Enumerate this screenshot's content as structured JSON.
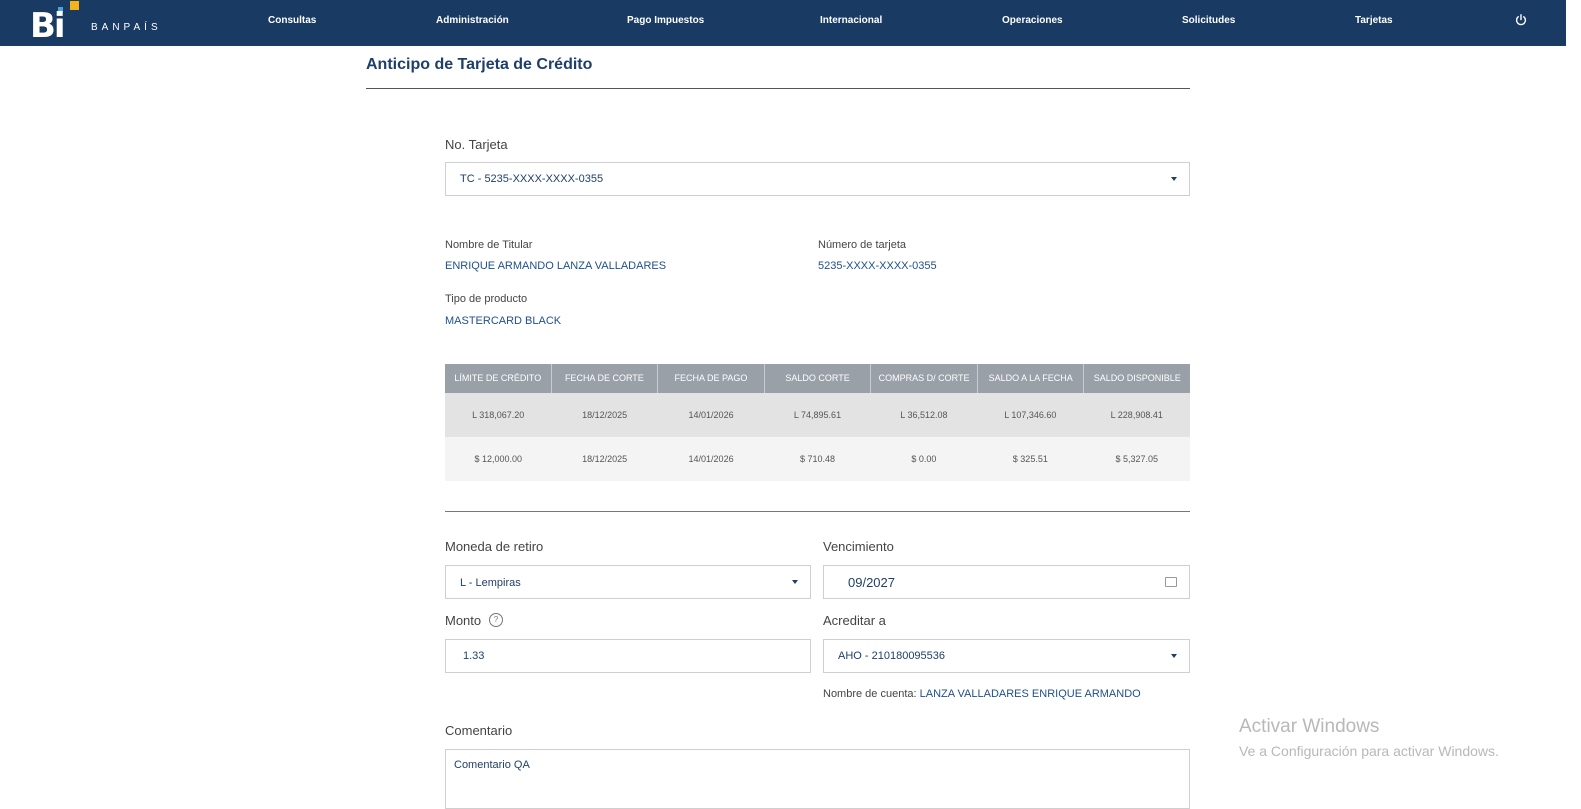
{
  "brand": {
    "logo": "Bi",
    "name": "BANPAÍS"
  },
  "nav": {
    "items": [
      "Consultas",
      "Administración",
      "Pago Impuestos",
      "Internacional",
      "Operaciones",
      "Solicitudes",
      "Tarjetas"
    ],
    "power_icon": "power-icon"
  },
  "page": {
    "title": "Anticipo de Tarjeta de Crédito"
  },
  "card_select": {
    "label": "No. Tarjeta",
    "value": "TC - 5235-XXXX-XXXX-0355"
  },
  "details": {
    "holder_label": "Nombre de Titular",
    "holder_value": "ENRIQUE ARMANDO LANZA VALLADARES",
    "card_number_label": "Número de tarjeta",
    "card_number_value": "5235-XXXX-XXXX-0355",
    "product_label": "Tipo de producto",
    "product_value": "MASTERCARD BLACK"
  },
  "balance_table": {
    "headers": [
      "LÍMITE DE CRÉDITO",
      "FECHA DE CORTE",
      "FECHA DE PAGO",
      "SALDO CORTE",
      "COMPRAS D/ CORTE",
      "SALDO A LA FECHA",
      "SALDO DISPONIBLE"
    ],
    "rows": [
      [
        "L 318,067.20",
        "18/12/2025",
        "14/01/2026",
        "L 74,895.61",
        "L 36,512.08",
        "L 107,346.60",
        "L 228,908.41"
      ],
      [
        "$ 12,000.00",
        "18/12/2025",
        "14/01/2026",
        "$ 710.48",
        "$ 0.00",
        "$ 325.51",
        "$ 5,327.05"
      ]
    ]
  },
  "form": {
    "currency_label": "Moneda de retiro",
    "currency_value": "L - Lempiras",
    "expiry_label": "Vencimiento",
    "expiry_value": "09/2027",
    "amount_label": "Monto",
    "amount_value": "1.33",
    "credit_to_label": "Acreditar a",
    "credit_to_value": "AHO - 210180095536",
    "account_name_label": "Nombre de cuenta:",
    "account_name_value": "LANZA VALLADARES ENRIQUE ARMANDO",
    "comment_label": "Comentario",
    "comment_value": "Comentario QA"
  },
  "watermark": {
    "line1": "Activar Windows",
    "line2": "Ve a Configuración para activar Windows."
  },
  "colors": {
    "nav_bg": "#183a63",
    "accent": "#1f4f8f",
    "table_header": "#9aa0a7"
  }
}
